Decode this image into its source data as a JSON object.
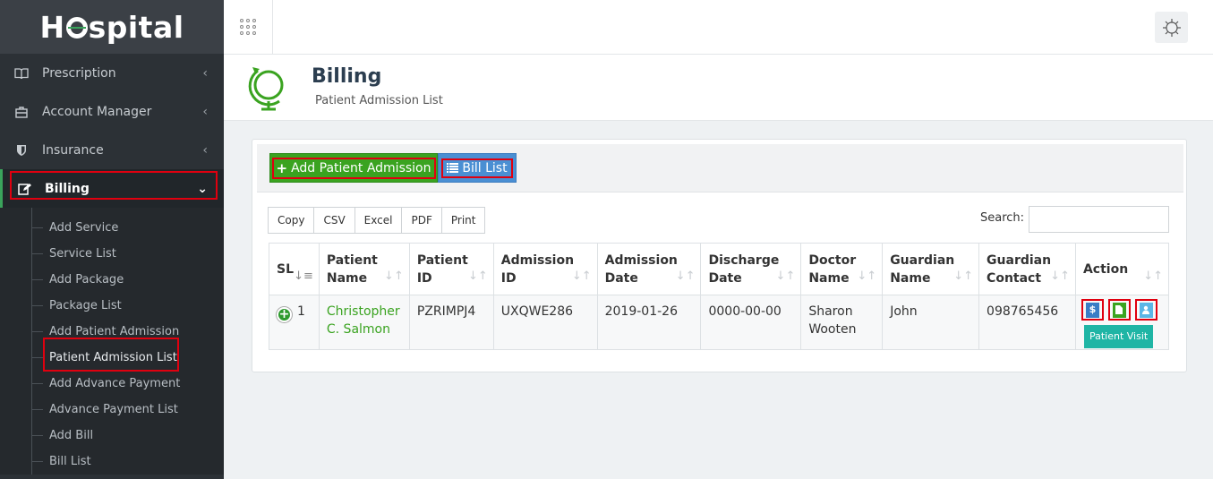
{
  "brand": {
    "logo_pre": "H",
    "logo_post": "spital"
  },
  "sidebar": {
    "items": [
      {
        "label": "Prescription",
        "icon": "book-icon"
      },
      {
        "label": "Account Manager",
        "icon": "briefcase-icon"
      },
      {
        "label": "Insurance",
        "icon": "shield-icon"
      },
      {
        "label": "Billing",
        "icon": "edit-icon",
        "active": true
      }
    ],
    "submenu": [
      "Add Service",
      "Service List",
      "Add Package",
      "Package List",
      "Add Patient Admission",
      "Patient Admission List",
      "Add Advance Payment",
      "Advance Payment List",
      "Add Bill",
      "Bill List"
    ]
  },
  "header": {
    "title": "Billing",
    "subtitle": "Patient Admission List"
  },
  "toolbar": {
    "add_label": "Add Patient Admission",
    "bill_list_label": "Bill List"
  },
  "exports": [
    "Copy",
    "CSV",
    "Excel",
    "PDF",
    "Print"
  ],
  "search": {
    "label": "Search:",
    "value": ""
  },
  "table": {
    "headers": [
      "SL",
      "Patient Name",
      "Patient ID",
      "Admission ID",
      "Admission Date",
      "Discharge Date",
      "Doctor Name",
      "Guardian Name",
      "Guardian Contact",
      "Action"
    ],
    "rows": [
      {
        "sl": "1",
        "patient_name": "Christopher C. Salmon",
        "patient_id": "PZRIMPJ4",
        "admission_id": "UXQWE286",
        "admission_date": "2019-01-26",
        "discharge_date": "0000-00-00",
        "doctor_name": "Sharon Wooten",
        "guardian_name": "John",
        "guardian_contact": "098765456",
        "action_tooltip": "Patient Visit"
      }
    ]
  },
  "colors": {
    "accent_green": "#3aa320",
    "sidebar_bg": "#2c3136",
    "highlight_red": "#e0000f",
    "tooltip_teal": "#1fb5a5"
  }
}
